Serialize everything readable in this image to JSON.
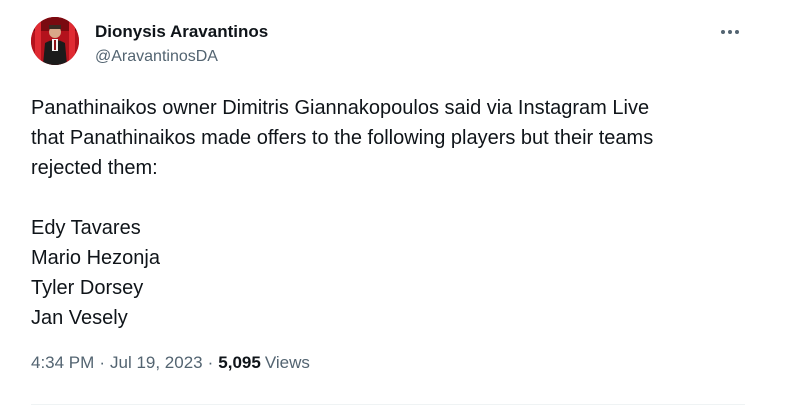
{
  "author": {
    "display_name": "Dionysis Aravantinos",
    "handle": "@AravantinosDA"
  },
  "icons": {
    "avatar": "profile-photo",
    "more": "more-options-icon"
  },
  "tweet": {
    "intro_line_1": "Panathinaikos owner Dimitris Giannakopoulos said via Instagram Live",
    "intro_line_2": "that Panathinaikos made offers to the following players but their teams",
    "intro_line_3": "rejected them:",
    "players": [
      "Edy Tavares",
      "Mario Hezonja",
      "Tyler Dorsey",
      "Jan Vesely"
    ]
  },
  "meta": {
    "time": "4:34 PM",
    "date": "Jul 19, 2023",
    "separator": "·",
    "views_count": "5,095",
    "views_label": "Views"
  },
  "colors": {
    "text_primary": "#0f1419",
    "text_secondary": "#536471",
    "divider": "#eff3f4"
  }
}
